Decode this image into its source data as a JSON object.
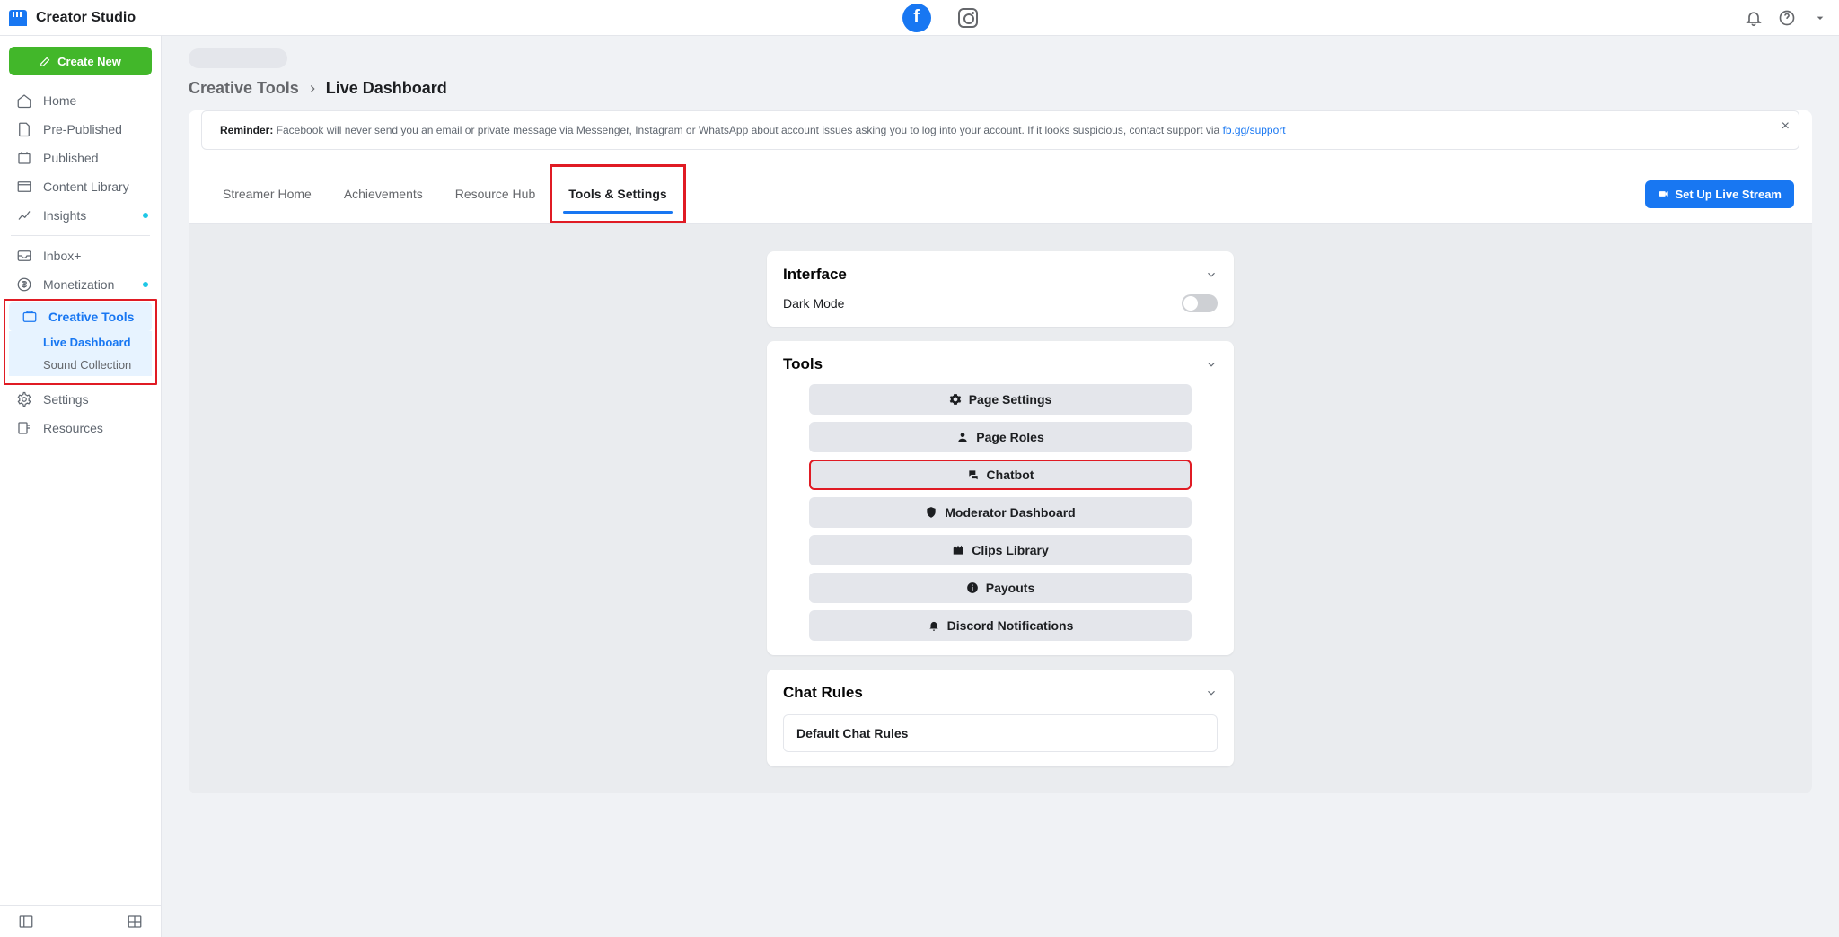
{
  "brand": "Creator Studio",
  "create_button": "Create New",
  "sidebar": {
    "items": [
      "Home",
      "Pre-Published",
      "Published",
      "Content Library",
      "Insights",
      "Inbox+",
      "Monetization",
      "Creative Tools",
      "Live Dashboard",
      "Sound Collection",
      "Settings",
      "Resources"
    ]
  },
  "breadcrumb": {
    "parent": "Creative Tools",
    "current": "Live Dashboard"
  },
  "notice": {
    "label": "Reminder:",
    "text": " Facebook will never send you an email or private message via Messenger, Instagram or WhatsApp about account issues asking you to log into your account. If it looks suspicious, contact support via ",
    "link": "fb.gg/support"
  },
  "tabs": [
    "Streamer Home",
    "Achievements",
    "Resource Hub",
    "Tools & Settings"
  ],
  "setup_btn": "Set Up Live Stream",
  "cards": {
    "interface": {
      "title": "Interface",
      "dark": "Dark Mode"
    },
    "tools": {
      "title": "Tools",
      "buttons": [
        "Page Settings",
        "Page Roles",
        "Chatbot",
        "Moderator Dashboard",
        "Clips Library",
        "Payouts",
        "Discord Notifications"
      ]
    },
    "chat_rules": {
      "title": "Chat Rules",
      "default": "Default Chat Rules"
    }
  }
}
